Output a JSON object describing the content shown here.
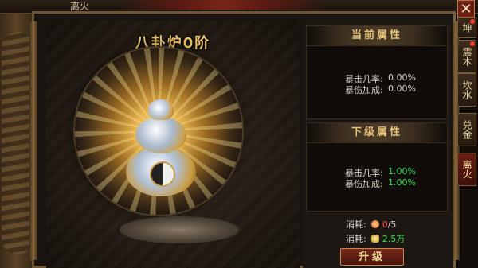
{
  "window": {
    "title": "离火"
  },
  "furnace": {
    "title": "八卦炉0阶"
  },
  "current": {
    "header": "当前属性",
    "stats": [
      {
        "label": "暴击几率:",
        "value": "0.00%"
      },
      {
        "label": "暴伤加成:",
        "value": "0.00%"
      }
    ]
  },
  "next": {
    "header": "下级属性",
    "stats": [
      {
        "label": "暴击几率:",
        "value": "1.00%"
      },
      {
        "label": "暴伤加成:",
        "value": "1.00%"
      }
    ]
  },
  "cost": {
    "label": "消耗:",
    "items": [
      {
        "icon": "fire-gem-icon",
        "have": "0",
        "need": "/5"
      },
      {
        "icon": "gold-ingot-icon",
        "amount": "2.5万"
      }
    ]
  },
  "upgrade": {
    "label": "升级"
  },
  "tabs": [
    {
      "label": "坤"
    },
    {
      "label": "震木"
    },
    {
      "label": "坎水"
    },
    {
      "label": "兑金"
    },
    {
      "label": "离火"
    }
  ],
  "close": {
    "label": "✕"
  }
}
